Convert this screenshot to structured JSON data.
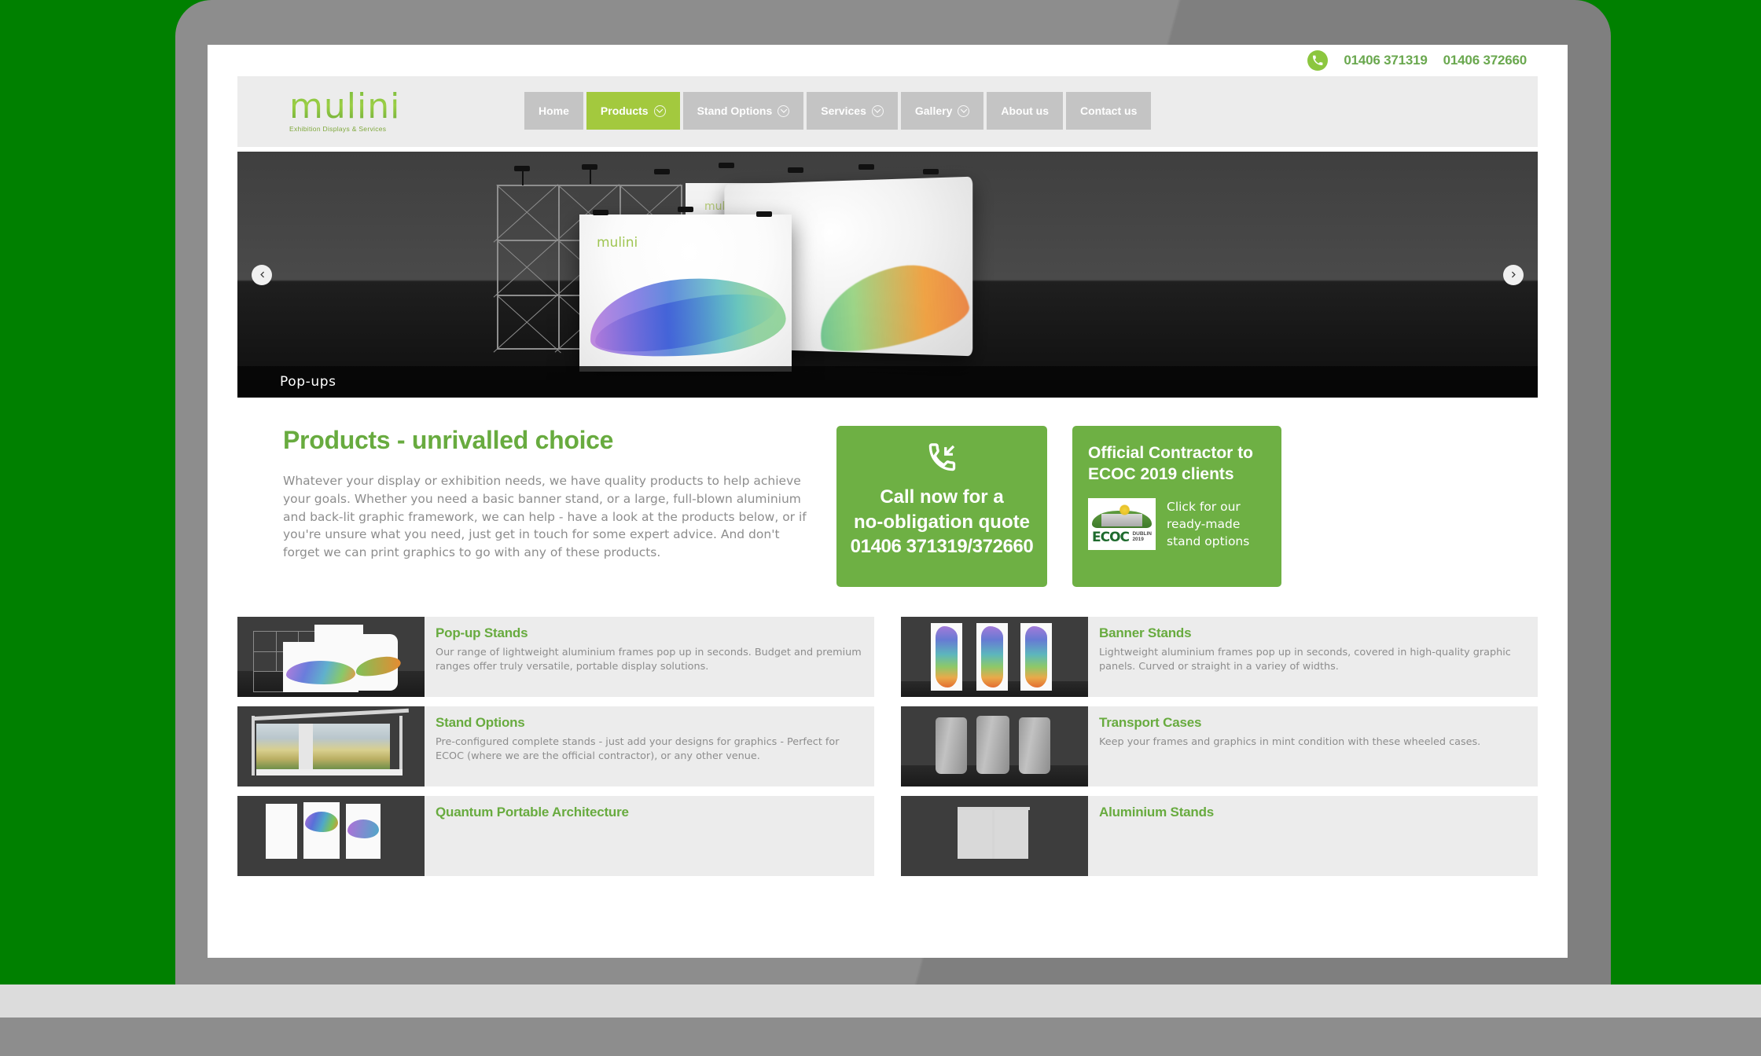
{
  "page": {
    "background_color": "#008000",
    "device": "laptop-mockup",
    "bezel_color": "#8d8d8d"
  },
  "topbar": {
    "phone_icon": "phone-icon",
    "phone_1": "01406 371319",
    "phone_2": "01406 372660",
    "accent_color": "#6aa84f"
  },
  "header": {
    "logo": {
      "wordmark": "mulini",
      "tagline": "Exhibition Displays & Services",
      "color": "#8cc63f"
    },
    "nav": [
      {
        "label": "Home",
        "has_dropdown": false,
        "active": false
      },
      {
        "label": "Products",
        "has_dropdown": true,
        "active": true
      },
      {
        "label": "Stand Options",
        "has_dropdown": true,
        "active": false
      },
      {
        "label": "Services",
        "has_dropdown": true,
        "active": false
      },
      {
        "label": "Gallery",
        "has_dropdown": true,
        "active": false
      },
      {
        "label": "About us",
        "has_dropdown": false,
        "active": false
      },
      {
        "label": "Contact us",
        "has_dropdown": false,
        "active": false
      }
    ],
    "active_color": "#a3c93e",
    "inactive_color": "#c4c4c4"
  },
  "hero": {
    "caption": "Pop-ups",
    "prev_icon": "chevron-left-icon",
    "next_icon": "chevron-right-icon",
    "stand_brand": "mulini"
  },
  "intro": {
    "title": "Products - unrivalled choice",
    "title_color": "#68ab3f",
    "body": "Whatever your display or exhibition needs, we have quality products to help achieve your goals. Whether you need a basic banner stand, or a large, full-blown aluminium and back-lit graphic framework, we can help - have a look at the products below, or if you're unsure what you need, just get in touch for some expert advice. And don't forget we can print graphics to go with any of these products."
  },
  "cta_call": {
    "icon": "phone-incoming-icon",
    "line1": "Call now for a",
    "line2": "no-obligation quote",
    "line3": "01406 371319/372660",
    "background": "#6eb044"
  },
  "cta_ecoc": {
    "title": "Official Contractor to ECOC 2019 clients",
    "logo_text": "ECOC",
    "logo_sub_line1": "DUBLIN",
    "logo_sub_line2": "2019",
    "caption": "Click for our ready-made stand options",
    "background": "#6eb044"
  },
  "products": [
    {
      "title": "Pop-up Stands",
      "desc": "Our range of lightweight aluminium frames pop up in seconds. Budget and premium ranges offer truly versatile, portable display solutions.",
      "thumb": "popup-stands-thumb"
    },
    {
      "title": "Banner Stands",
      "desc": "Lightweight aluminium frames pop up in seconds, covered in high-quality graphic panels. Curved or straight in a variey of widths.",
      "thumb": "banner-stands-thumb"
    },
    {
      "title": "Stand Options",
      "desc": "Pre-configured complete stands - just add your designs for graphics - Perfect for ECOC (where we are the official contractor), or any other venue.",
      "thumb": "stand-options-thumb"
    },
    {
      "title": "Transport Cases",
      "desc": "Keep your frames and graphics in mint condition with these wheeled cases.",
      "thumb": "transport-cases-thumb"
    },
    {
      "title": "Quantum Portable Architecture",
      "desc": "",
      "thumb": "quantum-portable-architecture-thumb"
    },
    {
      "title": "Aluminium Stands",
      "desc": "",
      "thumb": "aluminium-stands-thumb"
    }
  ]
}
